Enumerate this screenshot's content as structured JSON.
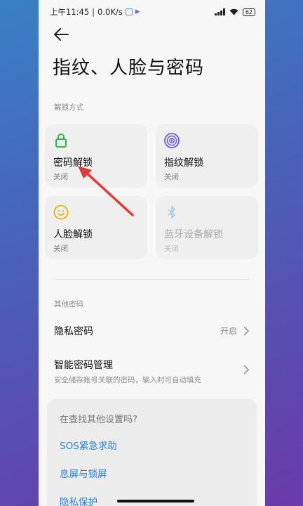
{
  "status_bar": {
    "time": "上午11:45",
    "speed": "0.0K/s",
    "battery": "62"
  },
  "header": {
    "title": "指纹、人脸与密码"
  },
  "unlock_section": {
    "label": "解锁方式",
    "tiles": [
      {
        "name": "密码解锁",
        "status": "关闭",
        "icon": "lock-icon",
        "color": "#2eb84a"
      },
      {
        "name": "指纹解锁",
        "status": "关闭",
        "icon": "fingerprint-icon",
        "color": "#6a5fd8"
      },
      {
        "name": "人脸解锁",
        "status": "关闭",
        "icon": "face-icon",
        "color": "#e8b400"
      },
      {
        "name": "蓝牙设备解锁",
        "status": "关闭",
        "icon": "bluetooth-icon",
        "color": "#a7c8ec"
      }
    ]
  },
  "other_section": {
    "label": "其他密码",
    "privacy_password": {
      "title": "隐私密码",
      "value": "开启"
    },
    "smart_password": {
      "title": "智能密码管理",
      "subtitle": "安全储存账号关联的密码，输入时可自动填充"
    }
  },
  "search_card": {
    "question": "在查找其他设置吗?",
    "links": [
      "SOS紧急求助",
      "息屏与锁屏",
      "隐私保护"
    ]
  },
  "colors": {
    "link": "#2c7fd6",
    "annotation_arrow": "#e53935"
  }
}
